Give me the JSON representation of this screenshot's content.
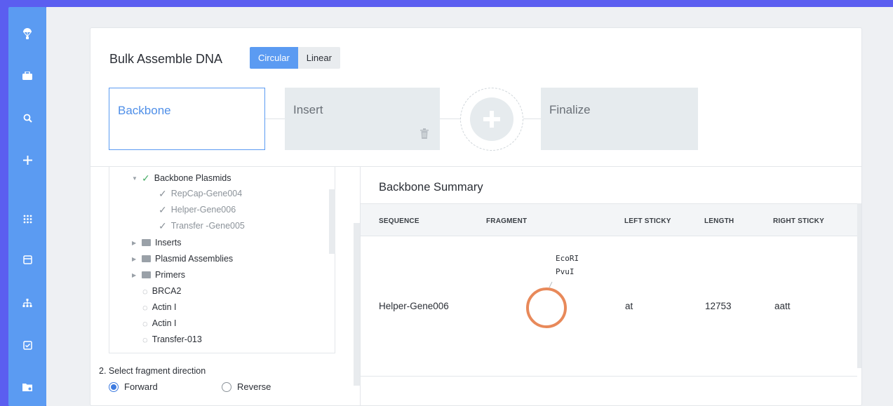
{
  "sidebar": {
    "items": [
      {
        "icon": "parachute-icon"
      },
      {
        "icon": "briefcase-icon"
      },
      {
        "icon": "search-icon"
      },
      {
        "icon": "plus-icon"
      },
      {
        "icon": "grid-icon"
      },
      {
        "icon": "inbox-icon"
      },
      {
        "icon": "hierarchy-icon"
      },
      {
        "icon": "checklist-icon"
      },
      {
        "icon": "folder-icon"
      }
    ],
    "color": "#5b9bf2"
  },
  "header": {
    "title": "Bulk Assemble DNA",
    "toggle": [
      "Circular",
      "Linear"
    ],
    "toggle_selected": "Circular"
  },
  "steps": {
    "backbone": "Backbone",
    "insert": "Insert",
    "finalize": "Finalize"
  },
  "tree": {
    "items": [
      {
        "label": "Backbone Plasmids",
        "type": "checked-group"
      },
      {
        "label": "RepCap-Gene004",
        "type": "checked-child"
      },
      {
        "label": "Helper-Gene006",
        "type": "checked-child"
      },
      {
        "label": "Transfer -Gene005",
        "type": "checked-child"
      },
      {
        "label": "Inserts",
        "type": "folder"
      },
      {
        "label": "Plasmid Assemblies",
        "type": "folder"
      },
      {
        "label": "Primers",
        "type": "folder"
      },
      {
        "label": "BRCA2",
        "type": "sequence"
      },
      {
        "label": "Actin I",
        "type": "sequence"
      },
      {
        "label": "Actin I",
        "type": "sequence"
      },
      {
        "label": "Transfer-013",
        "type": "sequence"
      }
    ]
  },
  "direction": {
    "label": "2. Select fragment direction",
    "options": [
      "Forward",
      "Reverse"
    ],
    "selected": "Forward"
  },
  "summary": {
    "title": "Backbone Summary",
    "columns": [
      "SEQUENCE",
      "FRAGMENT",
      "LEFT STICKY",
      "LENGTH",
      "RIGHT STICKY"
    ],
    "rows": [
      {
        "sequence": "Helper-Gene006",
        "fragment_labels": [
          "EcoRI",
          "PvuI"
        ],
        "left_sticky": "at",
        "length": "12753",
        "right_sticky": "aatt"
      }
    ]
  },
  "colors": {
    "accent": "#5b9bf2",
    "background": "#5b5ef0",
    "plasmid": "#e8895a"
  }
}
